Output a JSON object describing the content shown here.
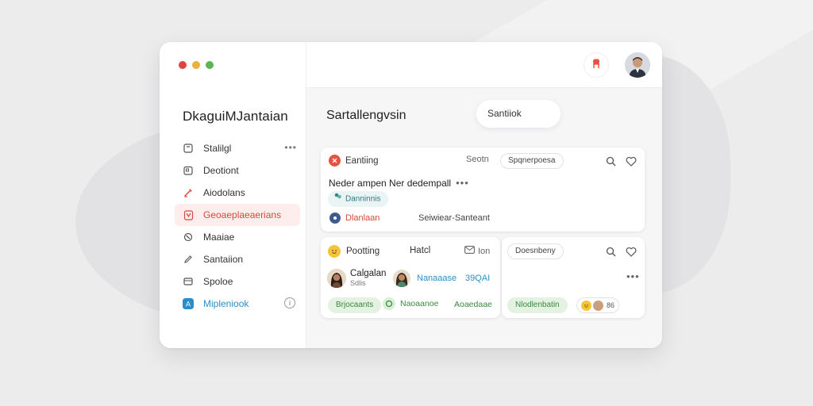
{
  "app": {
    "title": "DkaguiMJantaian",
    "colors": {
      "accent_red": "#d44a3f",
      "accent_blue": "#2a8fc9",
      "green": "#3a8a3e"
    }
  },
  "sidebar": {
    "items": [
      {
        "label": "Stalilgl",
        "icon": "bookmark-icon",
        "more": "•••"
      },
      {
        "label": "Deotiont",
        "icon": "calendar-icon"
      },
      {
        "label": "Aiodolans",
        "icon": "pencil-icon"
      },
      {
        "label": "Geoaeplaeaerians",
        "icon": "document-icon",
        "active": true
      },
      {
        "label": "Maaiae",
        "icon": "settings-icon"
      },
      {
        "label": "Santaiion",
        "icon": "edit-icon"
      },
      {
        "label": "Spoloe",
        "icon": "inbox-icon"
      },
      {
        "label": "Mipleniook",
        "icon": "app-icon",
        "info": "i"
      }
    ]
  },
  "main": {
    "heading": "Sartallengvsin",
    "search": {
      "placeholder": "Santiiok"
    }
  },
  "cards": [
    {
      "title": "Eantiing",
      "meta": "Seotn",
      "tag": "Spqnerpoesa",
      "message": "Neder ampen Ner dedempall",
      "chip": "Danninnis",
      "footer_left": "Dlanlaan",
      "footer_right": "Seiwiear-Santeant"
    },
    {
      "title": "Pootting",
      "subtitle": "Hatcl",
      "meta": "Ion",
      "tag": "Doesnbeny",
      "person": {
        "name": "Calgalan",
        "sub": "Sdlis"
      },
      "link": "Nanaaase",
      "count": "39QAI",
      "tags": [
        "Brjocaants",
        "Naoaanoe",
        "Aoaedaae"
      ]
    },
    {
      "chip": "Nlodlenbatin",
      "extra": "86"
    }
  ]
}
